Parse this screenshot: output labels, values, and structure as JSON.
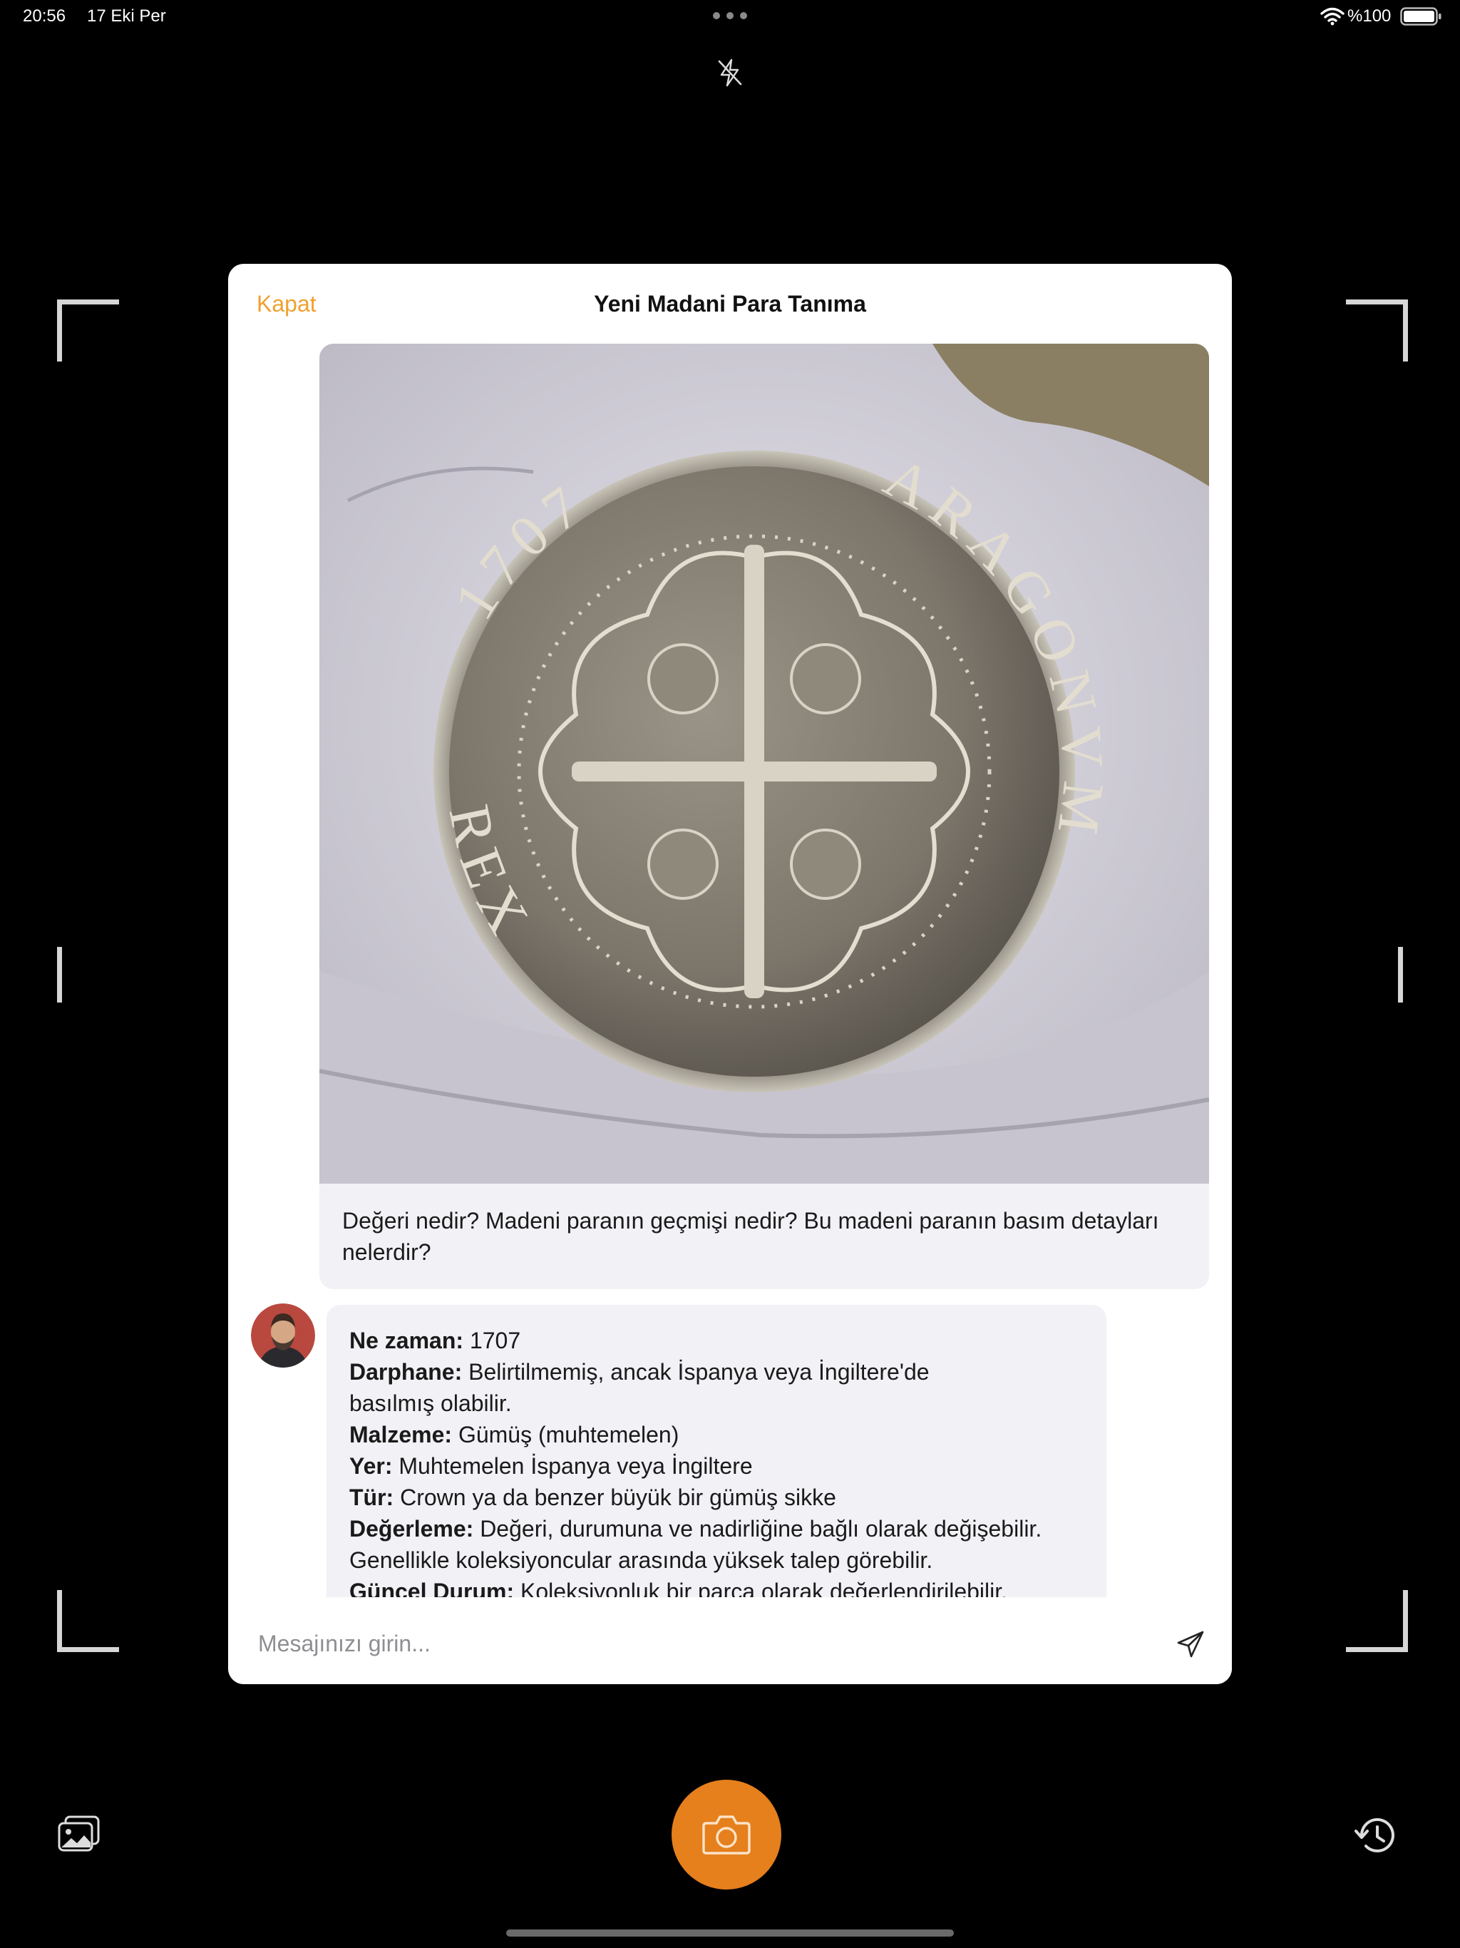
{
  "status_bar": {
    "time": "20:56",
    "date": "17 Eki Per",
    "battery": "%100"
  },
  "modal": {
    "close_label": "Kapat",
    "title": "Yeni Madani Para Tanıma",
    "accent_color": "#f0a030"
  },
  "chat": {
    "user_message": "Değeri nedir? Madeni paranın geçmişi nedir? Bu madeni paranın basım detayları nelerdir?",
    "coin_legend": {
      "year": "1707",
      "left": "REX",
      "right": "ARAGONVM"
    },
    "bot_lines": [
      {
        "label": "Ne zaman:",
        "value": " 1707"
      },
      {
        "label": "Darphane:",
        "value": " Belirtilmemiş, ancak İspanya veya İngiltere'de"
      },
      {
        "label": "",
        "value": "basılmış olabilir."
      },
      {
        "label": "Malzeme:",
        "value": " Gümüş (muhtemelen)"
      },
      {
        "label": "Yer:",
        "value": " Muhtemelen İspanya veya İngiltere"
      },
      {
        "label": "Tür:",
        "value": " Crown ya da benzer büyük bir gümüş sikke"
      },
      {
        "label": "Değerleme:",
        "value": " Değeri, durumuna ve nadirliğine bağlı olarak değişebilir."
      },
      {
        "label": "",
        "value": "Genellikle koleksiyoncular arasında yüksek talep görebilir."
      },
      {
        "label": "Güncel Durum:",
        "value": " Koleksiyonluk bir parça olarak değerlendirilebilir."
      }
    ]
  },
  "input": {
    "placeholder": "Mesajınızı girin...",
    "value": ""
  },
  "icons": {
    "flash": "flash-off-icon",
    "gallery": "photo-library-icon",
    "shutter": "camera-icon",
    "history": "history-icon",
    "send": "send-icon"
  },
  "colors": {
    "shutter": "#e5801d",
    "bubble": "#f1f1f6"
  }
}
